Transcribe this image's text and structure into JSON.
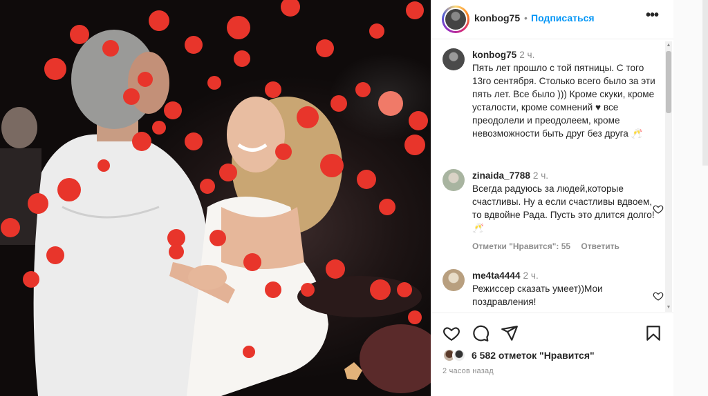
{
  "header": {
    "username": "konbog75",
    "dot": "•",
    "follow_label": "Подписаться",
    "more": "•••"
  },
  "caption": {
    "username": "konbog75",
    "time": "2 ч.",
    "text": "Пять лет прошло с той пятницы. С того 13го сентября. Столько всего было за эти пять лет. Все было ))) Кроме скуки, кроме усталости, кроме сомнений ♥ все преодолели и преодолеем, кроме невозможности быть друг без друга 🥂"
  },
  "comments": [
    {
      "username": "zinaida_7788",
      "time": "2 ч.",
      "text": "Всегда радуюсь за людей,которые счастливы. Ну а если счастливы вдвоем, то вдвойне Рада. Пусть это длится долго!🥂",
      "likes_label": "Отметки \"Нравится\": 55",
      "reply_label": "Ответить"
    },
    {
      "username": "me4ta4444",
      "time": "2 ч.",
      "text": "Режиссер сказать умеет))Мои поздравления!"
    }
  ],
  "actions": {
    "likes_count_label": "6 582 отметок \"Нравится\"",
    "time_ago": "2 часов назад"
  },
  "icons": [
    "heart-icon",
    "comment-icon",
    "share-icon",
    "bookmark-icon",
    "more-icon"
  ],
  "colors": {
    "accent": "#0095f6",
    "petal": "#e8352b"
  }
}
